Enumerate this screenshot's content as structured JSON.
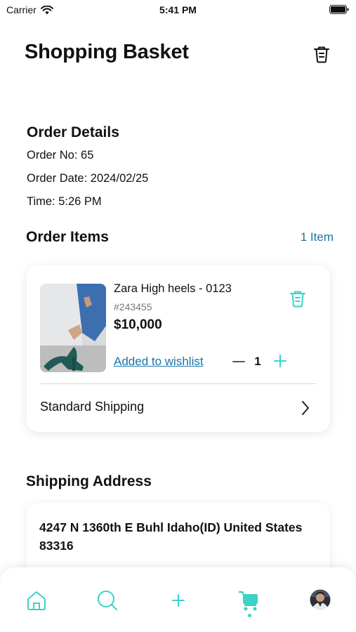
{
  "status_bar": {
    "carrier": "Carrier",
    "time": "5:41 PM"
  },
  "header": {
    "title": "Shopping Basket"
  },
  "order_details": {
    "title": "Order Details",
    "order_no": "Order No: 65",
    "order_date": "Order Date: 2024/02/25",
    "time": "Time: 5:26 PM"
  },
  "order_items": {
    "title": "Order Items",
    "count_label": "1 Item",
    "items": [
      {
        "name": "Zara High heels - 0123",
        "sku": "#243455",
        "price": "$10,000",
        "wishlist_label": "Added to wishlist",
        "quantity": "1"
      }
    ],
    "shipping_method": "Standard Shipping"
  },
  "shipping_address": {
    "title": "Shipping Address",
    "address": "4247 N 1360th E Buhl Idaho(ID) United States 83316"
  },
  "colors": {
    "accent": "#3ad3c7",
    "link": "#1a73a8"
  },
  "tab_bar": {
    "icons": [
      "home-icon",
      "search-icon",
      "plus-icon",
      "cart-icon",
      "profile-avatar"
    ],
    "active": "cart"
  }
}
